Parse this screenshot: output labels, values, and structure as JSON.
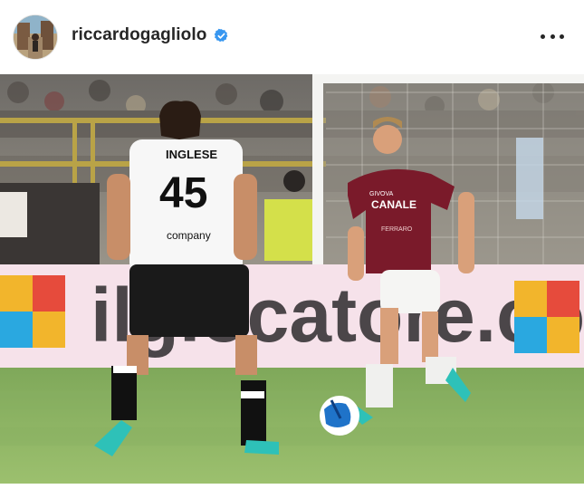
{
  "post": {
    "username": "riccardogagliolo",
    "verified_icon": "verified-badge-icon",
    "more_icon": "more-options-icon",
    "colors": {
      "verified": "#3897f0",
      "text": "#262626"
    }
  },
  "photo": {
    "left_player": {
      "name": "INGLESE",
      "number": "45",
      "sponsor": "company"
    },
    "right_player": {
      "sponsor_top": "CANALE",
      "sponsor_bottom": "FERRARO",
      "kit_brand": "GIVOVA"
    },
    "banner_text": "ilgiocatore.com"
  }
}
